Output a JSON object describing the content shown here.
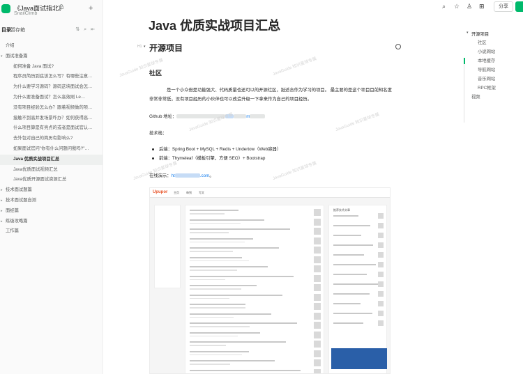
{
  "book": {
    "title": "《Java面试指北》",
    "subtitle": "SnailClimb"
  },
  "sidebar_tabs": {
    "active": "目录",
    "other": "暂存箱"
  },
  "nav": [
    {
      "label": "介绍",
      "level": 0,
      "caret": ""
    },
    {
      "label": "面试准备篇",
      "level": 0,
      "caret": "▾"
    },
    {
      "label": "如何准备 Java 面试?",
      "level": 1
    },
    {
      "label": "程序员简历到底该怎么写？有哪些注意…",
      "level": 1
    },
    {
      "label": "为什么要学习源码？源码这块面试会怎…",
      "level": 1
    },
    {
      "label": "为什么要准备面试？怎么高效刷 Le…",
      "level": 1
    },
    {
      "label": "没有项目经验怎么办？跟着视频做的项…",
      "level": 1
    },
    {
      "label": "接触不到高并发场景咋办？如何获得高…",
      "level": 1
    },
    {
      "label": "什么项目算是有亮点的或者是面试官认…",
      "level": 1
    },
    {
      "label": "去外包对自己的简历有影响么?",
      "level": 1
    },
    {
      "label": "如果面试官问\"你有什么问题问我吗?\"…",
      "level": 1
    },
    {
      "label": "Java 优质实战项目汇总",
      "level": 1,
      "active": true
    },
    {
      "label": "Java优质面试视频汇总",
      "level": 1
    },
    {
      "label": "Java优质开源面试资源汇总",
      "level": 1
    },
    {
      "label": "技术面试题篇",
      "level": 0,
      "caret": "▸"
    },
    {
      "label": "技术面试题自测",
      "level": 0,
      "caret": "▸"
    },
    {
      "label": "面经篇",
      "level": 0,
      "caret": "▸"
    },
    {
      "label": "练级攻略篇",
      "level": 0,
      "caret": "▸"
    },
    {
      "label": "工作篇",
      "level": 0,
      "caret": ""
    }
  ],
  "topbar": {
    "share": "分享"
  },
  "doc": {
    "title": "Java 优质实战项目汇总",
    "h_badge": "H1",
    "section": "开源项目",
    "subsection": "社区",
    "intro": "是一个小众但是功能强大、代码质量也还可以的开源社区，挺适合作为学习的项目。 最主要的是这个项目目前知名度非常非常低，没有项目经历的小伙伴也可以改造升级一下拿来作为自己的项目经历。",
    "github_label": "Github 地址：",
    "github_tail": "m",
    "stack_label": "技术栈：",
    "bullets": [
      "后端：Spring Boot + MySQL + Redis + Undertow（Web容器）",
      "前端：Thymeleaf（模板引擎，方便 SEO）+ Bootstrap"
    ],
    "demo_label": "在线演示：",
    "demo_link_start": "ht",
    "demo_link_end": ".com",
    "demo_suffix": "。"
  },
  "screenshot": {
    "logo": "Upupor",
    "tabs": [
      "主页",
      "每到",
      "写文"
    ],
    "right_head": "推荐技术文章"
  },
  "toc": {
    "items": [
      {
        "label": "开源项目",
        "level": 0
      },
      {
        "label": "社区",
        "level": 1
      },
      {
        "label": "小说网站",
        "level": 1
      },
      {
        "label": "本地缓存",
        "level": 1
      },
      {
        "label": "导航网站",
        "level": 1
      },
      {
        "label": "音乐网站",
        "level": 1
      },
      {
        "label": "RPC框架",
        "level": 1
      },
      {
        "label": "视频",
        "level": 0
      }
    ]
  },
  "watermark": "JavaGuide 知识星球专属"
}
